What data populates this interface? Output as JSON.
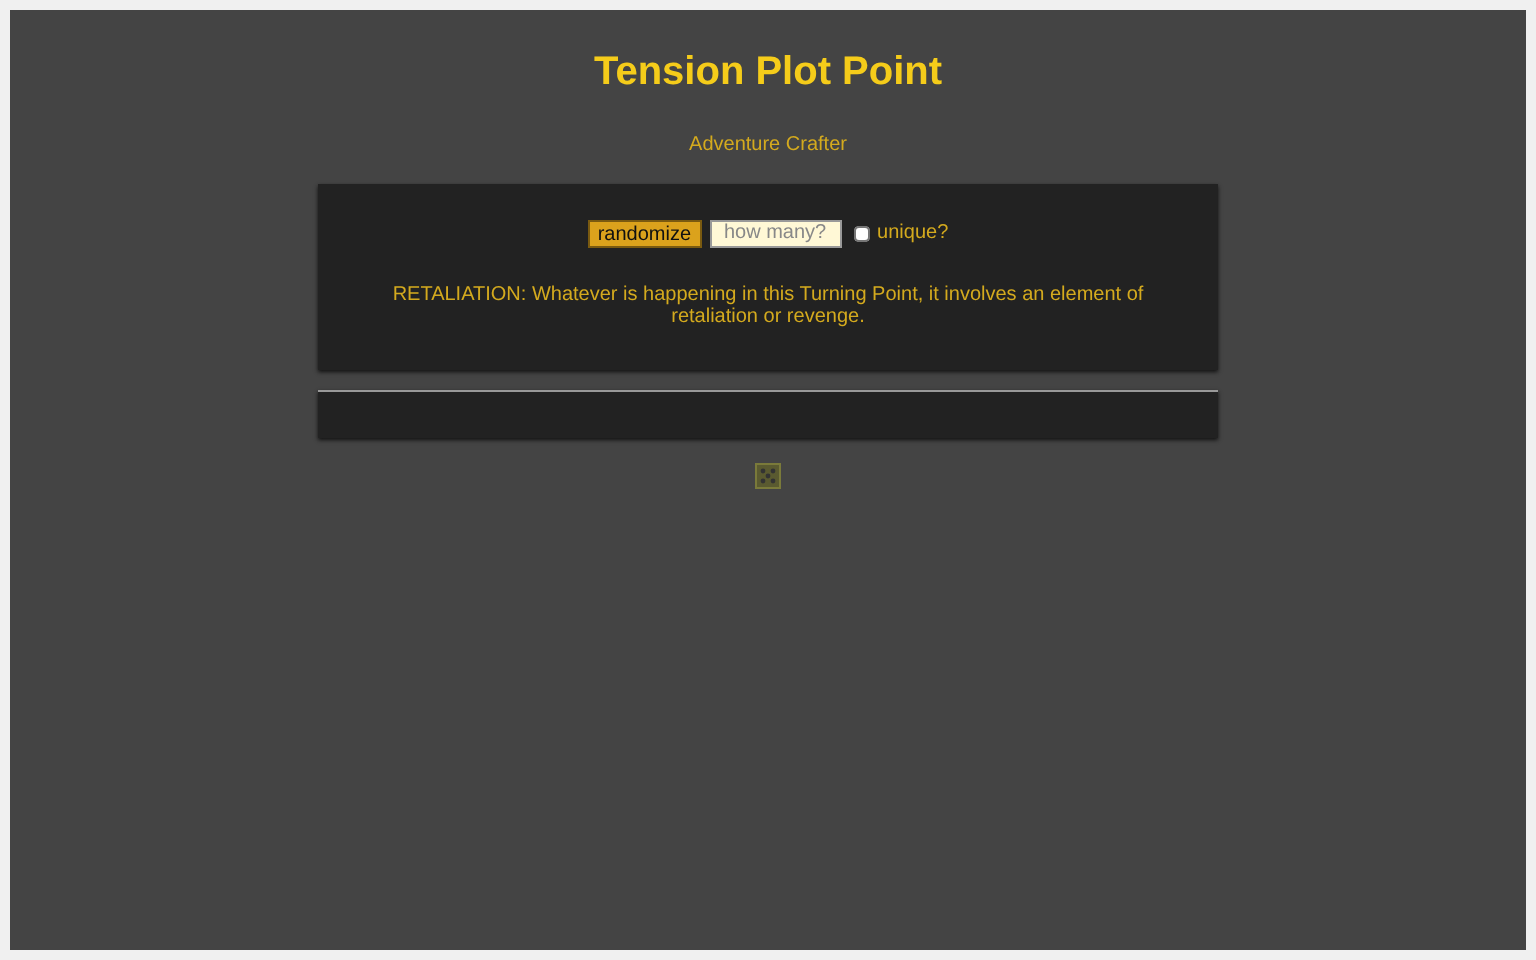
{
  "title": "Tension Plot Point",
  "subtitle": "Adventure Crafter",
  "controls": {
    "button": "randomize",
    "count": {
      "placeholder": "how many?"
    },
    "unique": {
      "label": "unique?",
      "checked": false
    }
  },
  "result": "RETALIATION: Whatever is happening in this Turning Point, it involves an element of retaliation or revenge."
}
